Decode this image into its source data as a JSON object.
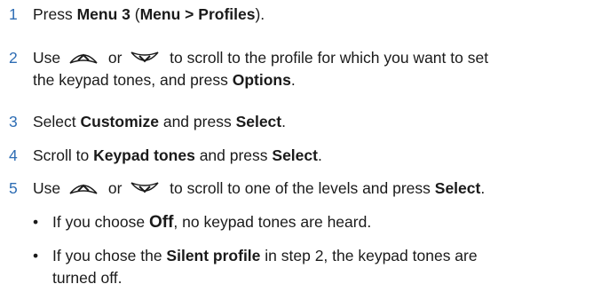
{
  "steps": [
    {
      "num": "1",
      "parts": {
        "a": "Press ",
        "b": "Menu 3",
        "c": " (",
        "d": "Menu",
        "e": " > ",
        "f": "Profiles",
        "g": ")."
      }
    },
    {
      "num": "2",
      "parts": {
        "a": "Use ",
        "b": " or ",
        "c": " to scroll to the profile for which you want to set",
        "d": "the keypad tones, and press ",
        "e": "Options",
        "f": "."
      },
      "icons": [
        "scroll-up-key-icon",
        "scroll-down-key-icon"
      ]
    },
    {
      "num": "3",
      "parts": {
        "a": "Select ",
        "b": "Customize",
        "c": " and press ",
        "d": "Select",
        "e": "."
      }
    },
    {
      "num": "4",
      "parts": {
        "a": "Scroll to ",
        "b": "Keypad tones",
        "c": " and press ",
        "d": "Select",
        "e": "."
      }
    },
    {
      "num": "5",
      "parts": {
        "a": "Use ",
        "b": " or ",
        "c": " to scroll to one of the levels and press ",
        "d": "Select",
        "e": "."
      },
      "icons": [
        "scroll-up-key-icon",
        "scroll-down-key-icon"
      ]
    }
  ],
  "bullets": [
    {
      "symbol": "•",
      "parts": {
        "a": "If you choose ",
        "b": "Off",
        "c": ", no keypad tones are heard."
      }
    },
    {
      "symbol": "•",
      "parts": {
        "a": "If you chose the ",
        "b": "Silent profile",
        "c": " in step 2, the keypad tones are",
        "d": "turned off."
      }
    }
  ],
  "colors": {
    "step_number": "#2e6db4",
    "text": "#1a1a1a"
  }
}
